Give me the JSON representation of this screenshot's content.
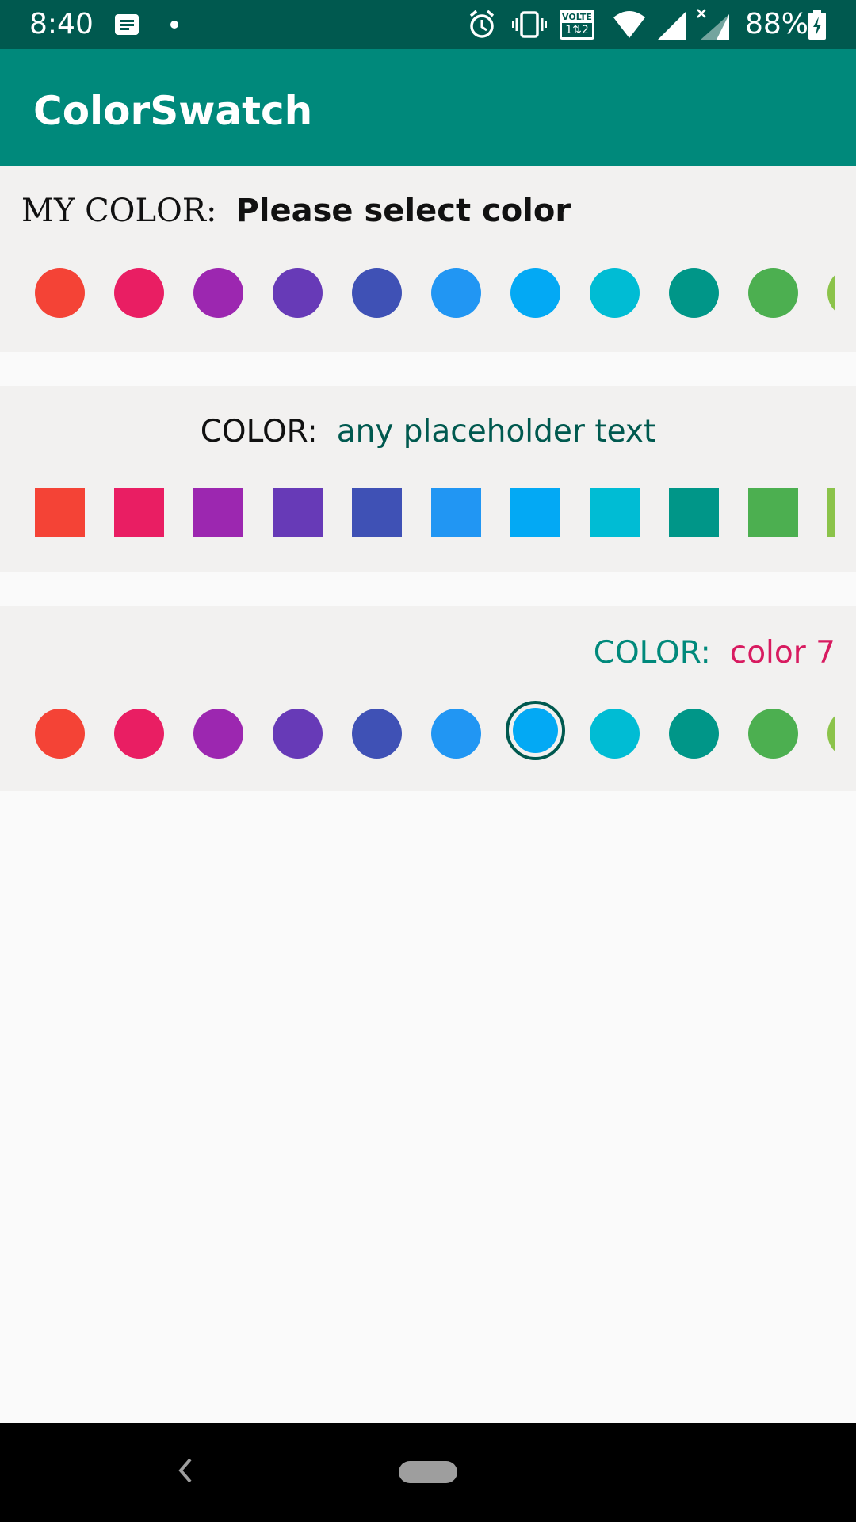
{
  "status_bar": {
    "time": "8:40",
    "battery": "88%",
    "network_label": "VOLTE"
  },
  "app_bar": {
    "title": "ColorSwatch"
  },
  "panel1": {
    "label": "MY COLOR:",
    "value": "Please select color"
  },
  "panel2": {
    "label": "COLOR:",
    "value": "any placeholder text"
  },
  "panel3": {
    "label": "COLOR:",
    "value": "color 7"
  },
  "swatch_colors": [
    "#f44336",
    "#e91e63",
    "#9c27b0",
    "#673ab7",
    "#3f51b5",
    "#2196f3",
    "#03a9f4",
    "#00bcd4",
    "#009688",
    "#4caf50",
    "#8bc34a"
  ],
  "selected_swatch_index": 6,
  "colors": {
    "status_bar": "#00594f",
    "app_bar": "#00897b",
    "panel_bg": "#f2f1f0",
    "accent_teal": "#00897b",
    "accent_pink": "#d81b60"
  }
}
